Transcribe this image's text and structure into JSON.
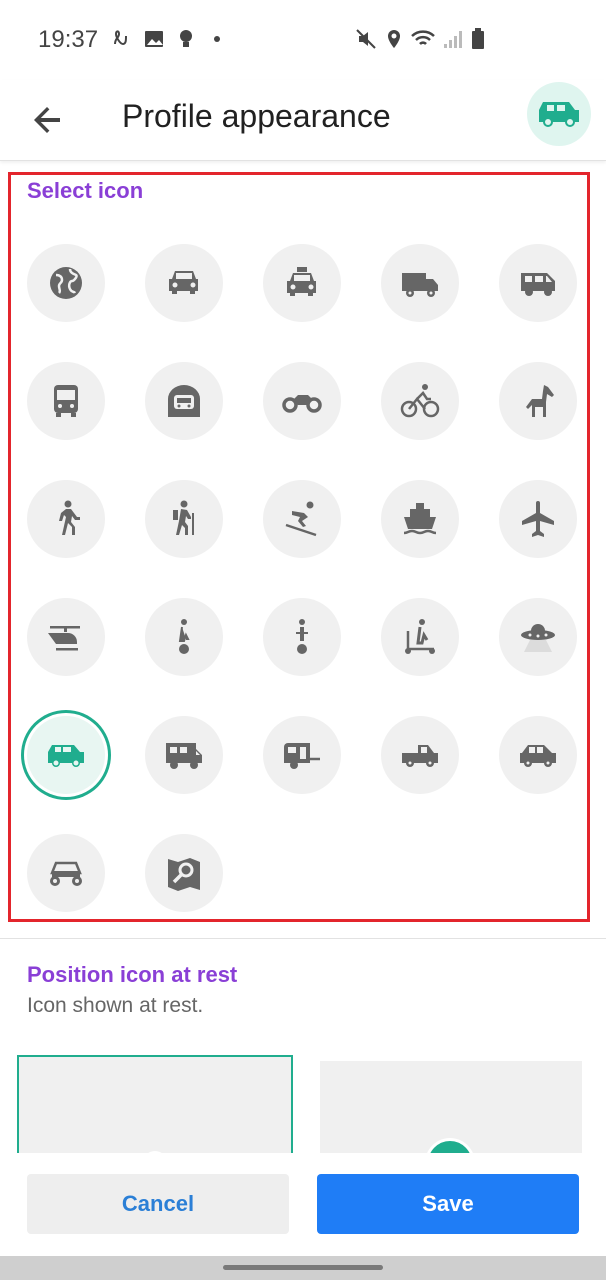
{
  "status_bar": {
    "time": "19:37"
  },
  "app_bar": {
    "title": "Profile appearance"
  },
  "select_icon": {
    "title": "Select icon",
    "icons": [
      "globe-icon",
      "car-icon",
      "taxi-icon",
      "truck-icon",
      "van-icon",
      "bus-icon",
      "subway-icon",
      "motorcycle-icon",
      "bicycle-icon",
      "horse-icon",
      "walking-icon",
      "hiking-icon",
      "skiing-icon",
      "ship-icon",
      "airplane-icon",
      "helicopter-icon",
      "unicycle-icon",
      "monowheel-icon",
      "scooter-icon",
      "ufo-icon",
      "suv-icon",
      "campervan-icon",
      "caravan-icon",
      "pickup-truck-icon",
      "car-side-icon",
      "buggy-icon",
      "map-search-icon"
    ],
    "selected": "suv-icon"
  },
  "position_icon": {
    "title": "Position icon at rest",
    "subtitle": "Icon shown at rest."
  },
  "buttons": {
    "cancel": "Cancel",
    "save": "Save"
  },
  "colors": {
    "accent_purple": "#8a3fd6",
    "teal": "#20ad8e",
    "save_blue": "#1f7df6",
    "highlight_red": "#e3252c"
  }
}
